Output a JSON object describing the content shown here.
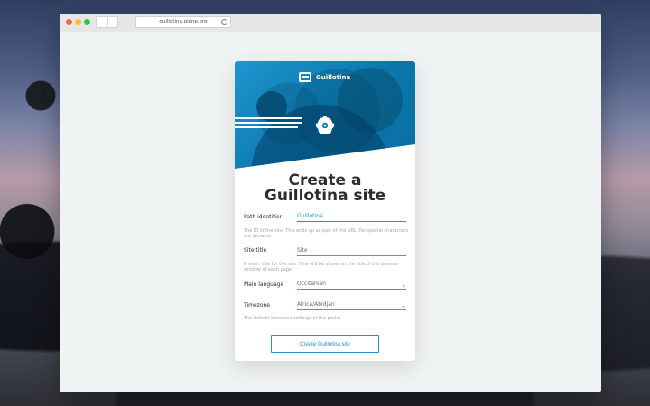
{
  "browser": {
    "url": "guillotina.plone.org"
  },
  "card": {
    "brand_name": "Guillotina",
    "title_line_1": "Create a",
    "title_line_2": "Guillotina site",
    "fields": [
      {
        "label": "Path identifier",
        "value": "Guillotina",
        "help": "The ID of the site. This ends up as part of the URL. No special characters are allowed."
      },
      {
        "label": "Site title",
        "value": "Site",
        "help": "A short title for the site. This will be shown in the title of the browser window of each page"
      },
      {
        "label": "Main language",
        "value": "Occitanian"
      },
      {
        "label": "Timezone",
        "value": "Africa/Abidjan",
        "help": "The default timezone settings of the portal"
      }
    ],
    "submit_label": "Create Guillotina site"
  },
  "icons": {
    "brand": "guillotina-logo-icon",
    "mascot": "robot-mascot-icon",
    "select": "chevron-down-icon",
    "reload": "reload-icon"
  },
  "colors": {
    "accent": "#1f91d2",
    "header_blue": "#0b78ad",
    "card_background": "#ffffff",
    "window_background": "#f0f3f4"
  }
}
